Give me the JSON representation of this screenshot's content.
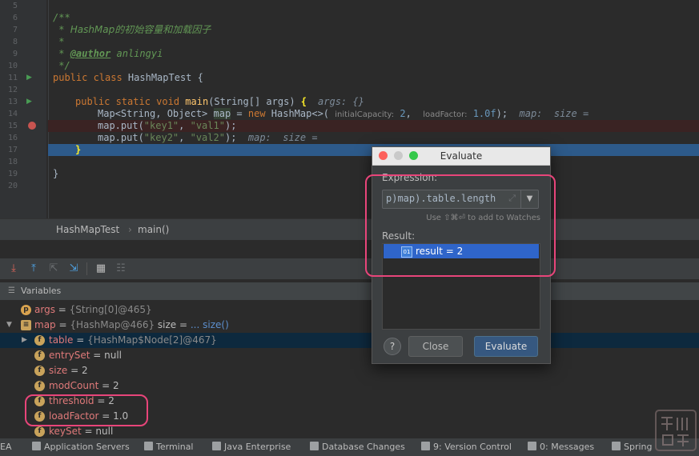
{
  "editor": {
    "line_numbers": [
      "5",
      "6",
      "7",
      "8",
      "9",
      "10",
      "11",
      "12",
      "13",
      "14",
      "15",
      "16",
      "17",
      "18",
      "19",
      "20"
    ],
    "lines": {
      "l6": "/**",
      "l7_star": " * ",
      "l7_text": "HashMap的初始容量和加载因子",
      "l8": " *",
      "l9_star": " * ",
      "l9_tag": "@author",
      "l9_text": " anlingyi",
      "l10": " */",
      "l11_kw": "public class ",
      "l11_name": "HashMapTest {",
      "l13_kw": "public static void ",
      "l13_fn": "main",
      "l13_rest": "(String[] args) ",
      "l13_brace": "{",
      "l13_hint": "args: {}",
      "l14_a": "Map<String, Object> ",
      "l14_map": "map",
      "l14_b": " = ",
      "l14_new": "new ",
      "l14_c": "HashMap<>(",
      "l14_h1": "initialCapacity:",
      "l14_n1": "2",
      "l14_comma": ",",
      "l14_h2": "loadFactor:",
      "l14_n2": "1.0f",
      "l14_end": ");",
      "l14_hint": "map:  size =",
      "l15_a": "map.put(",
      "l15_s1": "\"key1\"",
      "l15_sep": ", ",
      "l15_s2": "\"val1\"",
      "l15_end": ");",
      "l16_a": "map.put(",
      "l16_s1": "\"key2\"",
      "l16_sep": ", ",
      "l16_s2": "\"val2\"",
      "l16_end": ");",
      "l16_hint": "map:  size =",
      "l17": "}",
      "l19": "}"
    }
  },
  "breadcrumb": {
    "class_name": "HashMapTest",
    "separator": "›",
    "method": "main()"
  },
  "variables_panel": {
    "title": "Variables",
    "rows": [
      {
        "name": "args",
        "eq": " = ",
        "type": "{String[0]@465}",
        "extra": ""
      },
      {
        "name": "map",
        "eq": " = ",
        "type": "{HashMap@466}",
        "extra": " size = ",
        "link": "... size()"
      },
      {
        "name": "table",
        "eq": " = ",
        "type": "{HashMap$Node[2]@467}",
        "extra": ""
      },
      {
        "name": "entrySet",
        "eq": " = ",
        "value": "null"
      },
      {
        "name": "size",
        "eq": " = ",
        "value": "2"
      },
      {
        "name": "modCount",
        "eq": " = ",
        "value": "2"
      },
      {
        "name": "threshold",
        "eq": " = ",
        "value": "2"
      },
      {
        "name": "loadFactor",
        "eq": " = ",
        "value": "1.0"
      },
      {
        "name": "keySet",
        "eq": " = ",
        "value": "null"
      }
    ]
  },
  "statusbar": {
    "items": [
      "EA",
      "Application Servers",
      "Terminal",
      "Java Enterprise",
      "Database Changes",
      "9: Version Control",
      "0: Messages",
      "Spring"
    ]
  },
  "dialog": {
    "title": "Evaluate",
    "expression_label": "Expression:",
    "expression_value": "p)map).table.length",
    "expand_glyph": "⤢",
    "watch_hint": "Use ⇧⌘⏎ to add to Watches",
    "result_label": "Result:",
    "result_value": "result = 2",
    "result_badge": "01",
    "help_label": "?",
    "close_label": "Close",
    "evaluate_label": "Evaluate"
  },
  "watermark": {
    "text": "博凯 冨数"
  },
  "colors": {
    "accent_pink": "#e8457a",
    "selection_blue": "#2f65ca",
    "current_line": "#2d5a8a"
  }
}
